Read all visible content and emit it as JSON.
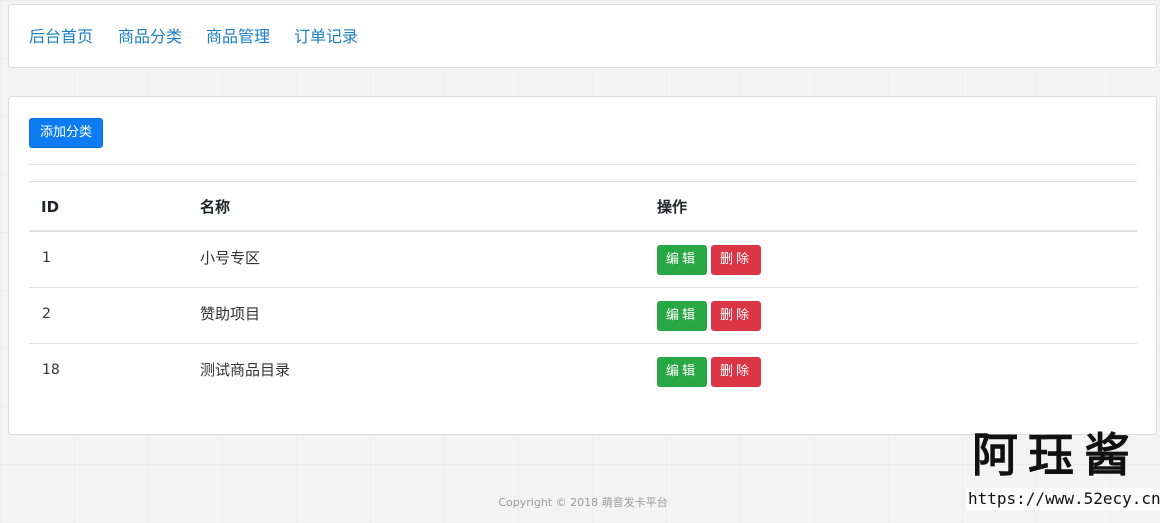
{
  "nav": {
    "items": [
      {
        "label": "后台首页"
      },
      {
        "label": "商品分类"
      },
      {
        "label": "商品管理"
      },
      {
        "label": "订单记录"
      }
    ]
  },
  "toolbar": {
    "add_label": "添加分类"
  },
  "table": {
    "headers": [
      "ID",
      "名称",
      "操作"
    ],
    "rows": [
      {
        "id": "1",
        "name": "小号专区",
        "edit": "编辑",
        "delete": "删除"
      },
      {
        "id": "2",
        "name": "赞助项目",
        "edit": "编辑",
        "delete": "删除"
      },
      {
        "id": "18",
        "name": "测试商品目录",
        "edit": "编辑",
        "delete": "删除"
      }
    ]
  },
  "footer": {
    "text": "Copyright © 2018 萌音发卡平台"
  },
  "watermark": {
    "title": "阿珏酱",
    "url": "https://www.52ecy.cn"
  },
  "colors": {
    "link": "#1a7fc3",
    "primary": "#0d7cf2",
    "success": "#28a745",
    "danger": "#dc3545"
  }
}
